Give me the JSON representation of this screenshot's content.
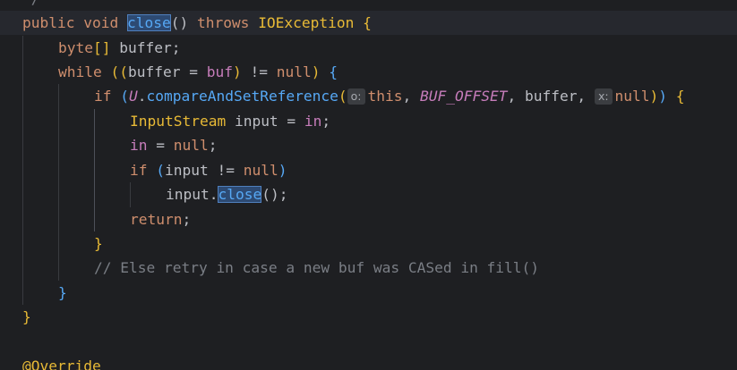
{
  "editor": {
    "lines": [
      {
        "tokens": [
          {
            "t": "*/",
            "c": "com"
          }
        ]
      },
      {
        "tokens": [
          {
            "t": "public ",
            "c": "kw"
          },
          {
            "t": "void ",
            "c": "kw"
          },
          {
            "t": "close",
            "c": "fn hl"
          },
          {
            "t": "() "
          },
          {
            "t": "throws ",
            "c": "kw"
          },
          {
            "t": "IOException ",
            "c": "cls"
          },
          {
            "t": "{",
            "c": "par1"
          }
        ]
      },
      {
        "tokens": [
          {
            "t": "byte",
            "c": "kw"
          },
          {
            "t": "[] ",
            "c": "par1"
          },
          {
            "t": "buffer;"
          }
        ]
      },
      {
        "tokens": [
          {
            "t": "while ",
            "c": "kw"
          },
          {
            "t": "((",
            "c": "par1"
          },
          {
            "t": "buffer = "
          },
          {
            "t": "buf",
            "c": "fld"
          },
          {
            "t": ") ",
            "c": "par1"
          },
          {
            "t": "!= "
          },
          {
            "t": "null",
            "c": "kw"
          },
          {
            "t": ") ",
            "c": "par1"
          },
          {
            "t": "{",
            "c": "par2"
          }
        ]
      },
      {
        "tokens": [
          {
            "t": "if ",
            "c": "kw"
          },
          {
            "t": "(",
            "c": "par2"
          },
          {
            "t": "U",
            "c": "static"
          },
          {
            "t": "."
          },
          {
            "t": "compareAndSetReference",
            "c": "fn"
          },
          {
            "t": "(",
            "c": "par1"
          },
          {
            "hint": "o:"
          },
          {
            "t": "this",
            "c": "kw"
          },
          {
            "t": ", "
          },
          {
            "t": "BUF_OFFSET",
            "c": "cst"
          },
          {
            "t": ", buffer, "
          },
          {
            "hint": "x:"
          },
          {
            "t": "null",
            "c": "kw"
          },
          {
            "t": ")",
            "c": "par1"
          },
          {
            "t": ") ",
            "c": "par2"
          },
          {
            "t": "{",
            "c": "par1"
          }
        ]
      },
      {
        "tokens": [
          {
            "t": "InputStream ",
            "c": "cls"
          },
          {
            "t": "input = "
          },
          {
            "t": "in",
            "c": "fld"
          },
          {
            "t": ";"
          }
        ]
      },
      {
        "tokens": [
          {
            "t": "in",
            "c": "fld"
          },
          {
            "t": " = "
          },
          {
            "t": "null",
            "c": "kw"
          },
          {
            "t": ";"
          }
        ]
      },
      {
        "tokens": [
          {
            "t": "if ",
            "c": "kw"
          },
          {
            "t": "(",
            "c": "par2"
          },
          {
            "t": "input != "
          },
          {
            "t": "null",
            "c": "kw"
          },
          {
            "t": ")",
            "c": "par2"
          }
        ]
      },
      {
        "tokens": [
          {
            "t": "input."
          },
          {
            "t": "close",
            "c": "fn hl"
          },
          {
            "t": "();"
          }
        ]
      },
      {
        "tokens": [
          {
            "t": "return",
            "c": "kw"
          },
          {
            "t": ";"
          }
        ]
      },
      {
        "tokens": [
          {
            "t": "}",
            "c": "par1"
          }
        ]
      },
      {
        "tokens": [
          {
            "t": "// Else retry in case a new buf was CASed in fill()",
            "c": "com"
          }
        ]
      },
      {
        "tokens": [
          {
            "t": "}",
            "c": "par2"
          }
        ]
      },
      {
        "tokens": [
          {
            "t": "}",
            "c": "par1"
          }
        ]
      },
      {
        "tokens": []
      },
      {
        "tokens": [
          {
            "t": "@Override",
            "c": "cls"
          }
        ]
      }
    ]
  }
}
